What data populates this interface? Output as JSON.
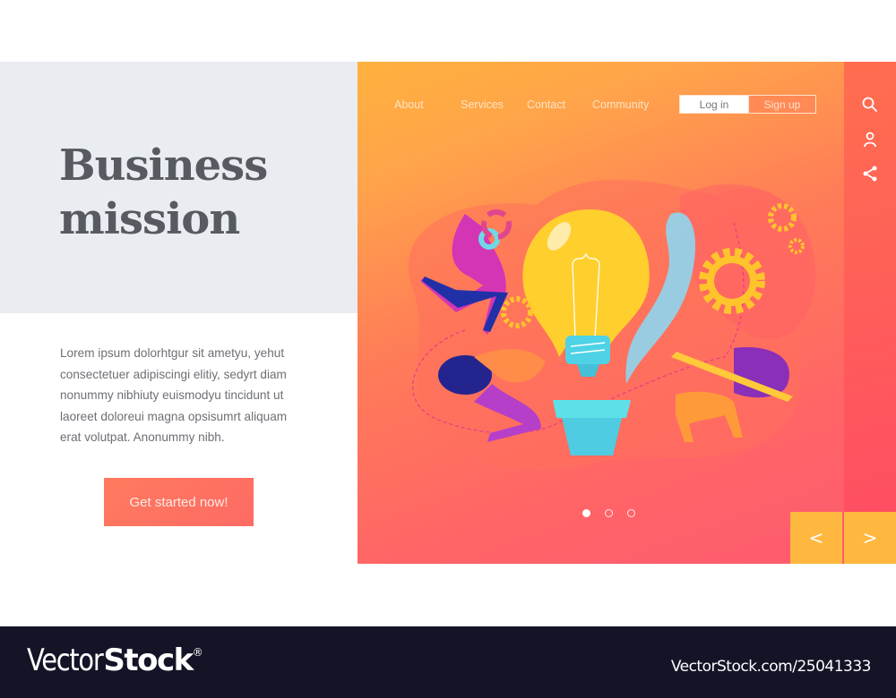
{
  "hero_section": {
    "title_lines": [
      "Business",
      "mission"
    ],
    "description": "Lorem ipsum dolorhtgur sit ametyu, yehut consectetuer adipiscingi elitiy, sedyrt diam nonummy nibhiuty euismodyu tincidunt ut laoreet doloreui magna opsisumrt aliquam erat volutpat. Anonummy nibh.",
    "cta_label": "Get started now!"
  },
  "nav": {
    "items": [
      {
        "label": "About"
      },
      {
        "label": "Services"
      },
      {
        "label": "Contact"
      },
      {
        "label": "Community"
      }
    ],
    "login_label": "Log in",
    "signup_label": "Sign up"
  },
  "sidebar": {
    "icons": [
      "search-icon",
      "user-icon",
      "share-icon"
    ]
  },
  "carousel": {
    "slide_count": 3,
    "active_index": 0,
    "prev_label": "<",
    "next_label": ">"
  },
  "illustration": {
    "subject": "lightbulb growing from plant pot with people, gears and pencil"
  },
  "footer": {
    "brand_light": "Vector",
    "brand_bold": "Stock",
    "brand_mark": "®",
    "stock_id": "VectorStock.com/25041333"
  },
  "colors": {
    "accent_orange": "#ffb13e",
    "accent_coral": "#ff6e5f",
    "accent_pink": "#ff5a70",
    "panel_gray": "#e9edf1",
    "title_gray": "#575b61",
    "footer_dark": "#131426"
  }
}
